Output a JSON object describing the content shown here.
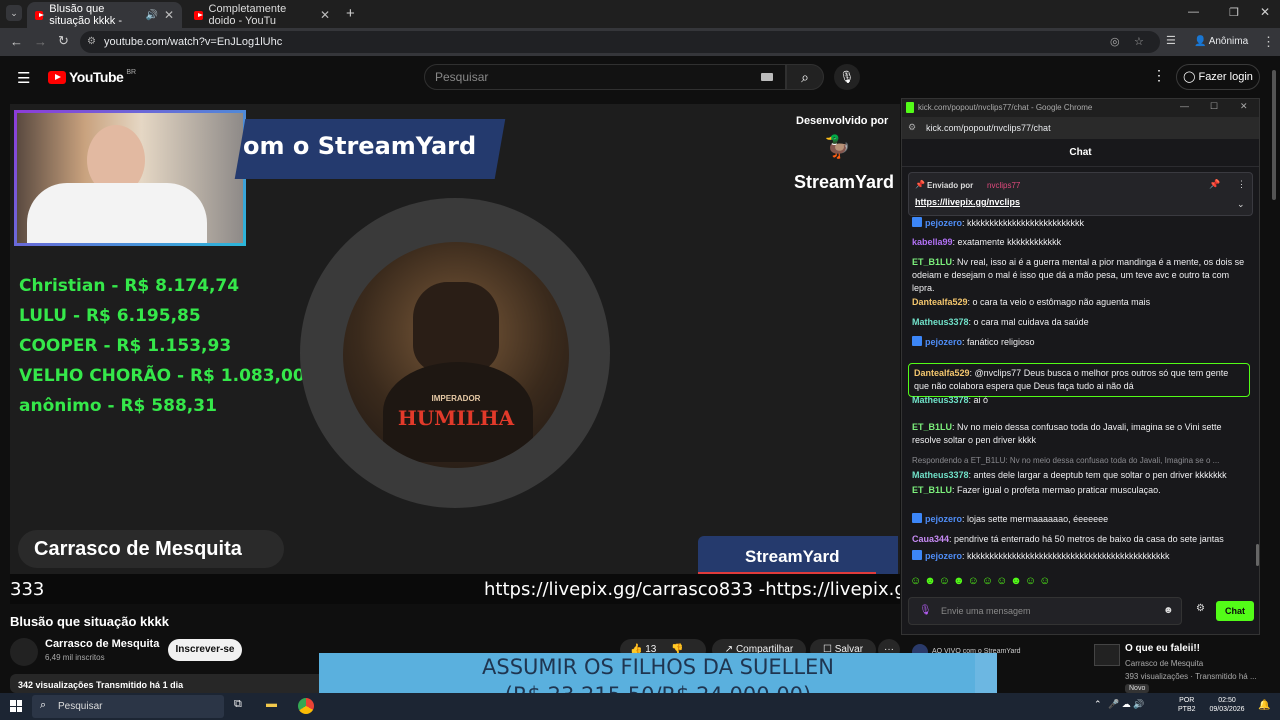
{
  "browser": {
    "tabs": [
      {
        "label": "Blusão que situação kkkk -"
      },
      {
        "label": "Completamente doido - YouTu"
      }
    ],
    "new_tab": "+",
    "url": "youtube.com/watch?v=EnJLog1lUhc",
    "profile_label": "Anônima"
  },
  "youtube": {
    "logo": "YouTube",
    "region": "BR",
    "search_placeholder": "Pesquisar",
    "login_label": "Fazer login"
  },
  "video": {
    "top_banner": "om o StreamYard",
    "dev_by": "Desenvolvido por",
    "brand": "StreamYard",
    "leaderboard": [
      "Christian - R$ 8.174,74",
      "LULU - R$ 6.195,85",
      "COOPER - R$ 1.153,93",
      "VELHO CHORÃO - R$ 1.083,00",
      "anônimo - R$ 588,31"
    ],
    "emblem_small": "IMPERADOR",
    "emblem_big": "HUMILHA",
    "name_tag": "Carrasco de Mesquita",
    "streamyard_bottom": "StreamYard",
    "ticker_left": "333",
    "ticker_right": "https://livepix.gg/carrasco833 -https://livepix.gg/"
  },
  "chat_popup": {
    "window_title": "kick.com/popout/nvclips77/chat - Google Chrome",
    "url": "kick.com/popout/nvclips77/chat",
    "header": "Chat",
    "pinned_label": "Enviado por",
    "pinned_user": "nvclips77",
    "pinned_link": "https://livepix.gg/nvclips",
    "input_placeholder": "Envie uma mensagem",
    "send_label": "Chat",
    "reply_context": "Respondendo a ET_B1LU: Nv no meio dessa confusao toda do Javali, Imagina se o ...",
    "messages": [
      {
        "user": "pejozero",
        "text": ": kkkkkkkkkkkkkkkkkkkkkkkkkk",
        "color": "#4f8df7"
      },
      {
        "user": "kabella99",
        "text": ": exatamente kkkkkkkkkkkk",
        "color": "#b271f5"
      },
      {
        "user": "ET_B1LU",
        "text": ": Nv real, isso ai é a guerra mental a pior mandinga é a mente, os dois se odeiam e desejam o mal é isso que dá a mão pesa, um teve avc e outro ta com lepra.",
        "color": "#7cf07c"
      },
      {
        "user": "Dantealfa529",
        "text": ": o cara ta veio o estômago não aguenta mais",
        "color": "#f3c66e"
      },
      {
        "user": "Matheus3378",
        "text": ": o cara mal cuidava da saúde",
        "color": "#70e0c8"
      },
      {
        "user": "pejozero",
        "text": ": fanático religioso",
        "color": "#4f8df7"
      },
      {
        "user": "Dantealfa529",
        "text": ": @nvclips77 Deus busca o melhor pros outros só que tem gente que não colabora espera que Deus faça tudo ai não dá",
        "color": "#f3c66e"
      },
      {
        "user": "Matheus3378",
        "text": ": ai ó",
        "color": "#70e0c8"
      },
      {
        "user": "ET_B1LU",
        "text": ": Nv no meio dessa confusao toda do Javali, imagina se o Vini sette resolve soltar o pen driver kkkk",
        "color": "#7cf07c"
      },
      {
        "user": "Matheus3378",
        "text": ": antes dele largar a deeptub tem que soltar o pen driver kkkkkkk",
        "color": "#70e0c8"
      },
      {
        "user": "ET_B1LU",
        "text": ": Fazer igual o profeta mermao praticar musculaçao.",
        "color": "#7cf07c"
      },
      {
        "user": "pejozero",
        "text": ": lojas sette mermaaaaaao, éeeeeee",
        "color": "#4f8df7"
      },
      {
        "user": "Caua344",
        "text": ": pendrive tá enterrado há 50 metros de baixo da casa do sete jantas",
        "color": "#c78bf5"
      },
      {
        "user": "pejozero",
        "text": ": kkkkkkkkkkkkkkkkkkkkkkkkkkkkkkkkkkkkkkkkkkkkk",
        "color": "#4f8df7"
      }
    ]
  },
  "below": {
    "title": "Blusão que situação kkkk",
    "channel": "Carrasco de Mesquita",
    "subs": "6,49 mil inscritos",
    "subscribe": "Inscrever-se",
    "likes": "13",
    "share": "Compartilhar",
    "save": "Salvar",
    "more": "···",
    "views": "342 visualizações  Transmitido há 1 dia",
    "live_label": "AO VIVO com o StreamYard",
    "rec_title": "O que eu faleii!!",
    "rec_channel": "Carrasco de Mesquita",
    "rec_meta": "393 visualizações · Transmitido há ...",
    "rec_badge": "Novo"
  },
  "overlay": {
    "line1": "ASSUMIR OS FILHOS DA SUELLEN",
    "line2": "(R$ 23.215,50/R$ 24.000,00)",
    "progress": 0.967
  },
  "taskbar": {
    "search": "Pesquisar",
    "lang1": "POR",
    "lang2": "PTB2",
    "time": "02:50",
    "date": "09/03/2026"
  }
}
